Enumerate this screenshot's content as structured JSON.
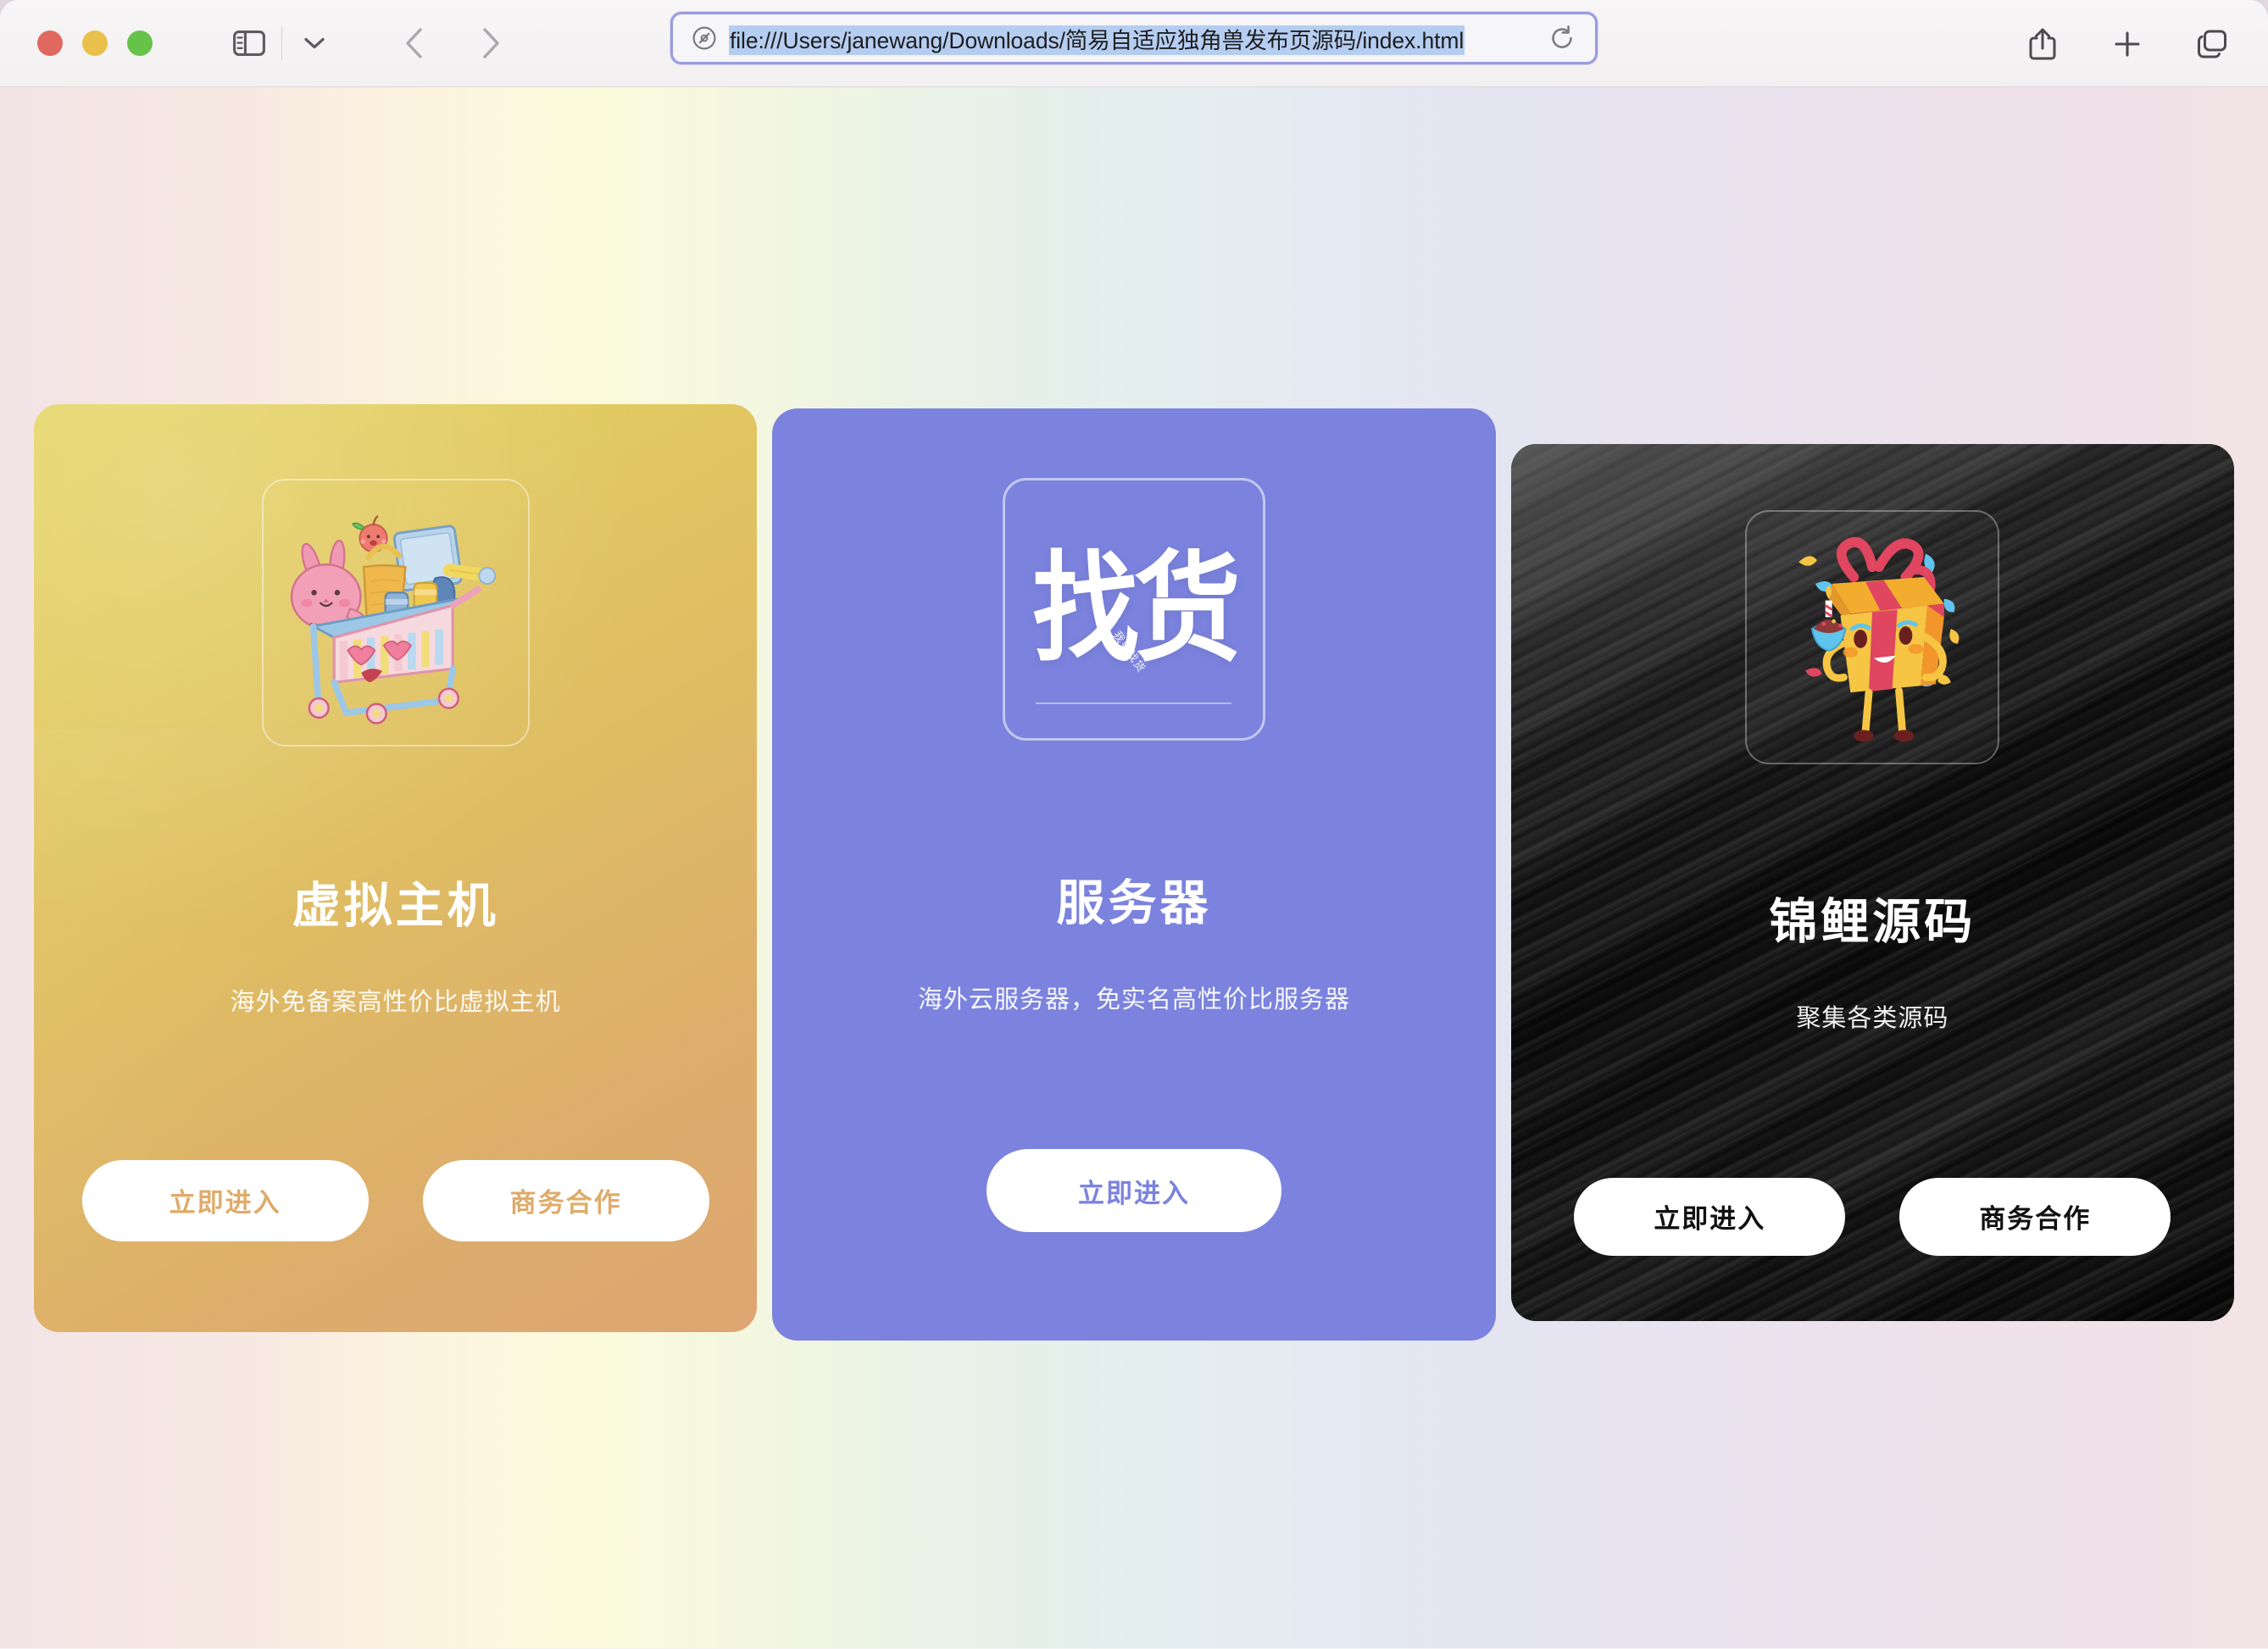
{
  "browser": {
    "name": "Safari",
    "traffic_lights": [
      "close",
      "minimize",
      "zoom"
    ],
    "sidebar_toggle": "sidebar-icon",
    "tab_group_chevron": "chevron-down-icon",
    "back": "back-arrow-icon",
    "forward": "forward-arrow-icon",
    "url": "file:///Users/janewang/Downloads/简易自适应独角兽发布页源码/index.html",
    "url_selected": true,
    "url_prefix_icon": "shield-privacy-icon",
    "reload": "reload-icon",
    "share": "share-icon",
    "new_tab": "plus-icon",
    "tab_overview": "tabs-icon"
  },
  "page": {
    "background_gradient": [
      "#f2e3e6",
      "#fdf4df",
      "#f4f7e0",
      "#e4efee",
      "#e5e4f1",
      "#f2e3e6"
    ],
    "cards": [
      {
        "id": "virtual-host",
        "icon_name": "shopping-cart-illustration",
        "title": "虚拟主机",
        "subtitle": "海外免备案高性价比虚拟主机",
        "accent": "#dfab6a",
        "background": "#e0c662",
        "buttons": [
          {
            "label": "立即进入",
            "name": "enter-button"
          },
          {
            "label": "商务合作",
            "name": "business-cooperation-button"
          }
        ]
      },
      {
        "id": "server",
        "icon_name": "zhaohuo-logo",
        "icon_text": "找货",
        "icon_micro_text": "我要找货",
        "title": "服务器",
        "subtitle": "海外云服务器，免实名高性价比服务器",
        "accent": "#7b83de",
        "background": "#7b83de",
        "buttons": [
          {
            "label": "立即进入",
            "name": "enter-button"
          }
        ]
      },
      {
        "id": "source-code",
        "icon_name": "gift-box-character-illustration",
        "title": "锦鲤源码",
        "subtitle": "聚集各类源码",
        "accent": "#111111",
        "background": "#161616",
        "buttons": [
          {
            "label": "立即进入",
            "name": "enter-button"
          },
          {
            "label": "商务合作",
            "name": "business-cooperation-button"
          }
        ]
      }
    ]
  }
}
